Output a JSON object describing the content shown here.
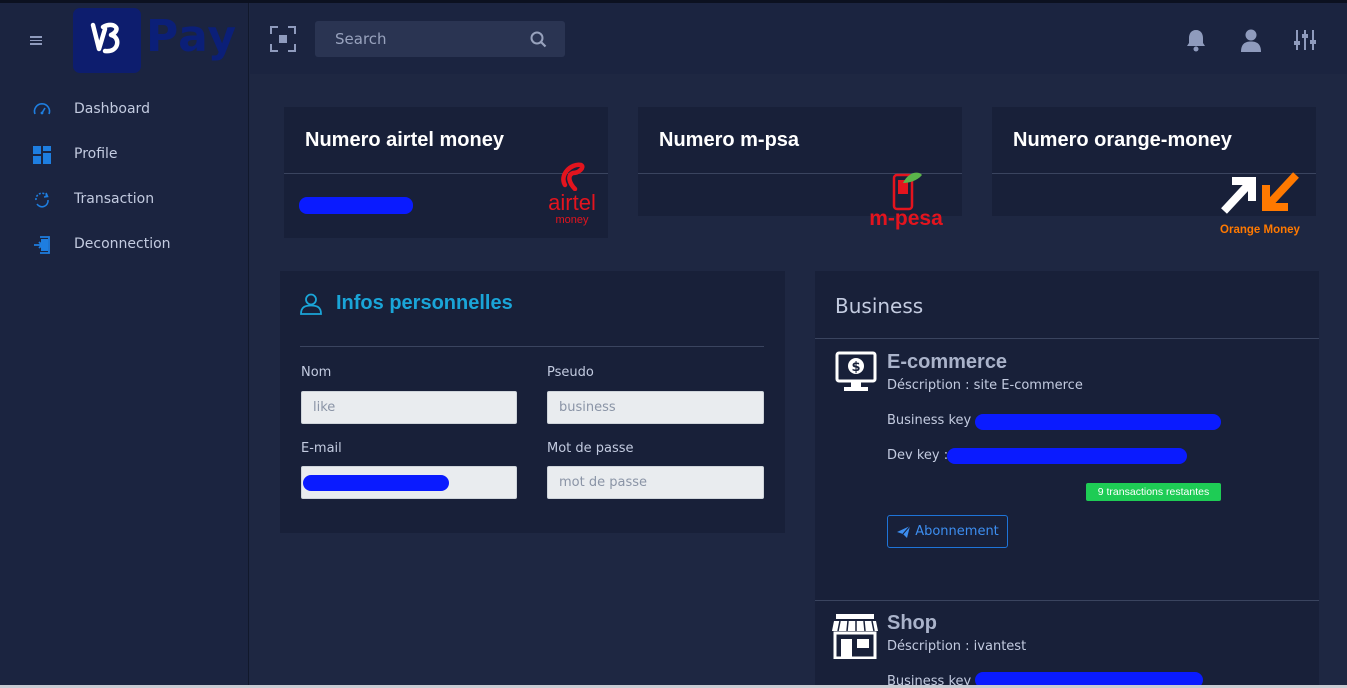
{
  "brand": {
    "name": "Pay"
  },
  "sidebar": {
    "items": [
      {
        "label": "Dashboard",
        "icon": "dashboard-gauge-icon"
      },
      {
        "label": "Profile",
        "icon": "profile-grid-icon"
      },
      {
        "label": "Transaction",
        "icon": "transaction-refresh-icon"
      },
      {
        "label": "Deconnection",
        "icon": "logout-icon"
      }
    ]
  },
  "topbar": {
    "search_placeholder": "Search"
  },
  "money_cards": [
    {
      "title": "Numero airtel money",
      "logo_line1": "airtel",
      "logo_line2": "money"
    },
    {
      "title": "Numero m-psa",
      "logo_text": "m-pesa"
    },
    {
      "title": "Numero orange-money",
      "logo_text": "Orange Money"
    }
  ],
  "personal_info": {
    "title": "Infos personnelles",
    "fields": {
      "nom": {
        "label": "Nom",
        "placeholder": "like"
      },
      "pseudo": {
        "label": "Pseudo",
        "placeholder": "business"
      },
      "email": {
        "label": "E-mail",
        "placeholder": ""
      },
      "password": {
        "label": "Mot de passe",
        "placeholder": "mot de passe"
      }
    }
  },
  "business": {
    "title": "Business",
    "items": [
      {
        "name": "E-commerce",
        "description": "Déscription : site E-commerce",
        "business_key_label": "Business key :",
        "dev_key_label": "Dev key :",
        "badge": "9 transactions restantes",
        "button": "Abonnement"
      },
      {
        "name": "Shop",
        "description": "Déscription : ivantest",
        "business_key_label": "Business key :"
      }
    ]
  },
  "colors": {
    "accent": "#1aa5d8",
    "badge": "#1ecc55",
    "button": "#1e74d8",
    "redaction": "#0a1bff",
    "airtel": "#e3141e",
    "orange": "#ff7900"
  }
}
